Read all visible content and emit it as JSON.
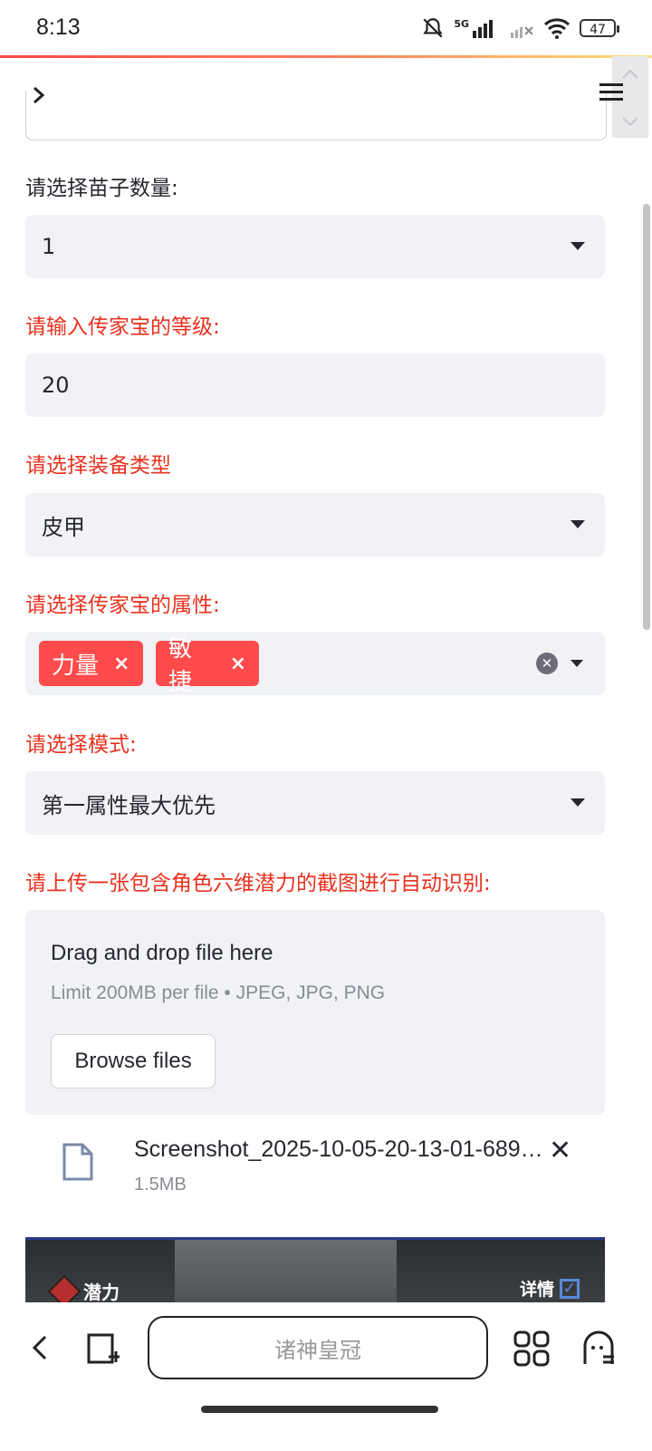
{
  "status_bar": {
    "time": "8:13",
    "network": "5G",
    "battery": "47"
  },
  "form": {
    "seedling_label": "请选择苗子数量:",
    "seedling_value": "1",
    "heirloom_level_label": "请输入传家宝的等级:",
    "heirloom_level_value": "20",
    "equipment_type_label": "请选择装备类型",
    "equipment_type_value": "皮甲",
    "attributes_label": "请选择传家宝的属性:",
    "attributes": [
      {
        "label": "力量",
        "remove": "×"
      },
      {
        "label": "敏捷",
        "remove": "×"
      }
    ],
    "mode_label": "请选择模式:",
    "mode_value": "第一属性最大优先",
    "upload_label": "请上传一张包含角色六维潜力的截图进行自动识别:"
  },
  "uploader": {
    "title": "Drag and drop file here",
    "limit": "Limit 200MB per file • JPEG, JPG, PNG",
    "browse": "Browse files"
  },
  "file": {
    "name": "Screenshot_2025-10-05-20-13-01-689…",
    "size": "1.5MB",
    "remove": "✕"
  },
  "preview": {
    "potential": "潜力",
    "detail": "详情"
  },
  "nav": {
    "search": "诸神皇冠"
  },
  "colors": {
    "accent": "#ff4b4b",
    "label_red": "#e8321e",
    "field_bg": "#f0f2f6"
  }
}
